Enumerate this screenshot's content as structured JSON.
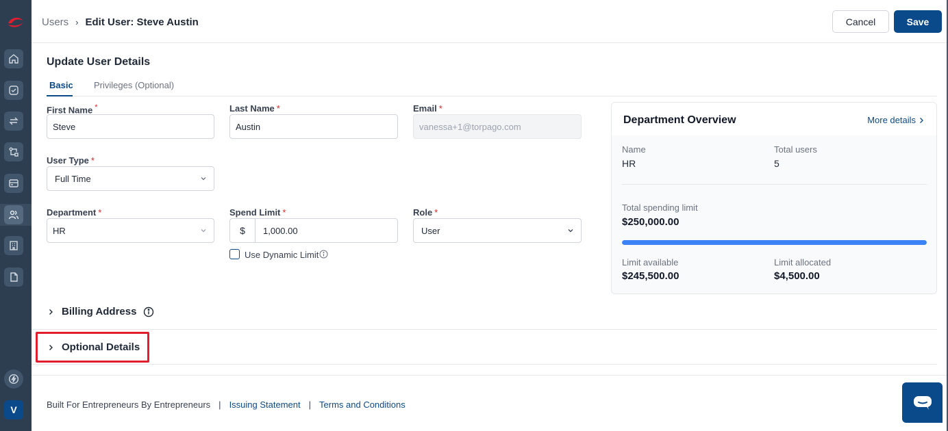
{
  "header": {
    "breadcrumb_parent": "Users",
    "breadcrumb_current": "Edit User: Steve Austin",
    "cancel_label": "Cancel",
    "save_label": "Save"
  },
  "sidebar": {
    "avatar_initial": "V",
    "items": [
      "home-icon",
      "check-circle-icon",
      "transfer-icon",
      "workflow-icon",
      "card-icon",
      "users-icon",
      "building-icon",
      "document-icon"
    ],
    "bottom_icon": "bolt-icon"
  },
  "form": {
    "title": "Update User Details",
    "tabs": [
      {
        "label": "Basic",
        "active": true
      },
      {
        "label": "Privileges (Optional)",
        "active": false
      }
    ],
    "first_name": {
      "label": "First Name",
      "value": "Steve"
    },
    "last_name": {
      "label": "Last Name",
      "value": "Austin"
    },
    "email": {
      "label": "Email",
      "placeholder": "vanessa+1@torpago.com"
    },
    "user_type": {
      "label": "User Type",
      "value": "Full Time"
    },
    "department": {
      "label": "Department",
      "value": "HR"
    },
    "spend_limit": {
      "label": "Spend Limit",
      "currency": "$",
      "value": "1,000.00"
    },
    "role": {
      "label": "Role",
      "value": "User"
    },
    "dynamic_limit": {
      "label": "Use Dynamic Limit",
      "checked": false
    },
    "required_mark": "*"
  },
  "department_overview": {
    "title": "Department Overview",
    "more_details": "More details",
    "name_label": "Name",
    "name_value": "HR",
    "total_users_label": "Total users",
    "total_users_value": "5",
    "total_spending_label": "Total spending limit",
    "total_spending_value": "$250,000.00",
    "limit_available_label": "Limit available",
    "limit_available_value": "$245,500.00",
    "limit_allocated_label": "Limit allocated",
    "limit_allocated_value": "$4,500.00",
    "progress_fraction": 1.0
  },
  "sections": {
    "billing_address": "Billing Address",
    "optional_details": "Optional Details"
  },
  "footer": {
    "tagline": "Built For Entrepreneurs By Entrepreneurs",
    "separator": "|",
    "issuing_statement": "Issuing Statement",
    "terms": "Terms and Conditions"
  },
  "colors": {
    "primary": "#0b4a8a",
    "sidebar": "#2d3e50",
    "progress": "#3b82f6",
    "highlight": "#e11d2e"
  }
}
